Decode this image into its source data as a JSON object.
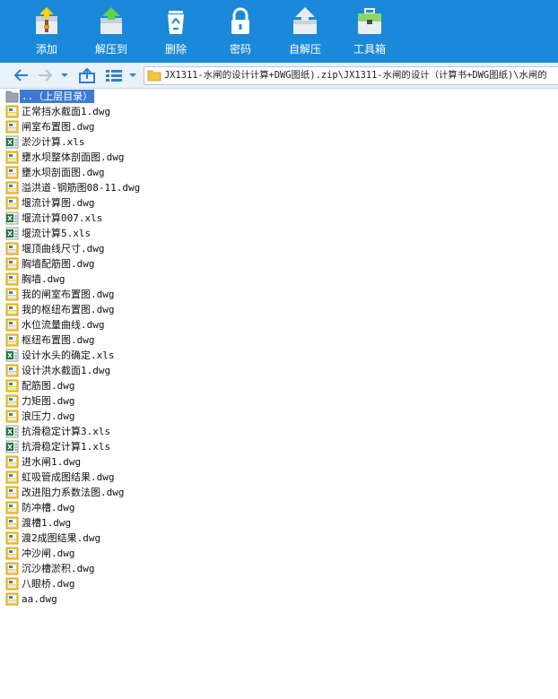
{
  "toolbar": {
    "buttons": [
      {
        "label": "添加",
        "icon": "add-archive-icon"
      },
      {
        "label": "解压到",
        "icon": "extract-to-icon"
      },
      {
        "label": "删除",
        "icon": "recycle-bin-icon"
      },
      {
        "label": "密码",
        "icon": "padlock-icon"
      },
      {
        "label": "自解压",
        "icon": "self-extract-icon"
      },
      {
        "label": "工具箱",
        "icon": "toolbox-icon"
      }
    ],
    "accent": "#1a89d9"
  },
  "address": {
    "path": "JX1311-水闸的设计计算+DWG图纸).zip\\JX1311-水闸的设计（计算书+DWG图纸)\\水闸的"
  },
  "files": [
    {
      "name": "..（上层目录）",
      "type": "parent"
    },
    {
      "name": "正常挡水截面1.dwg",
      "type": "dwg"
    },
    {
      "name": "闸室布置图.dwg",
      "type": "dwg"
    },
    {
      "name": "淤沙计算.xls",
      "type": "xls"
    },
    {
      "name": "壅水坝整体剖面图.dwg",
      "type": "dwg"
    },
    {
      "name": "壅水坝剖面图.dwg",
      "type": "dwg"
    },
    {
      "name": "溢洪道-钢筋图08-11.dwg",
      "type": "dwg"
    },
    {
      "name": "堰流计算图.dwg",
      "type": "dwg"
    },
    {
      "name": "堰流计算007.xls",
      "type": "xls"
    },
    {
      "name": "堰流计算5.xls",
      "type": "xls"
    },
    {
      "name": "堰顶曲线尺寸.dwg",
      "type": "dwg"
    },
    {
      "name": "胸墙配筋图.dwg",
      "type": "dwg"
    },
    {
      "name": "胸墙.dwg",
      "type": "dwg"
    },
    {
      "name": "我的闸室布置图.dwg",
      "type": "dwg"
    },
    {
      "name": "我的枢纽布置图.dwg",
      "type": "dwg"
    },
    {
      "name": "水位流量曲线.dwg",
      "type": "dwg"
    },
    {
      "name": "枢纽布置图.dwg",
      "type": "dwg"
    },
    {
      "name": "设计水头的确定.xls",
      "type": "xls"
    },
    {
      "name": "设计洪水截面1.dwg",
      "type": "dwg"
    },
    {
      "name": "配筋图.dwg",
      "type": "dwg"
    },
    {
      "name": "力矩图.dwg",
      "type": "dwg"
    },
    {
      "name": "浪压力.dwg",
      "type": "dwg"
    },
    {
      "name": "抗滑稳定计算3.xls",
      "type": "xls"
    },
    {
      "name": "抗滑稳定计算1.xls",
      "type": "xls"
    },
    {
      "name": "进水闸1.dwg",
      "type": "dwg"
    },
    {
      "name": "虹吸管成图结果.dwg",
      "type": "dwg"
    },
    {
      "name": "改进阻力系数法图.dwg",
      "type": "dwg"
    },
    {
      "name": "防冲槽.dwg",
      "type": "dwg"
    },
    {
      "name": "渡槽1.dwg",
      "type": "dwg"
    },
    {
      "name": "渡2成图结果.dwg",
      "type": "dwg"
    },
    {
      "name": "冲沙闸.dwg",
      "type": "dwg"
    },
    {
      "name": "沉沙槽淤积.dwg",
      "type": "dwg"
    },
    {
      "name": "八眼桥.dwg",
      "type": "dwg"
    },
    {
      "name": "aa.dwg",
      "type": "dwg"
    }
  ]
}
